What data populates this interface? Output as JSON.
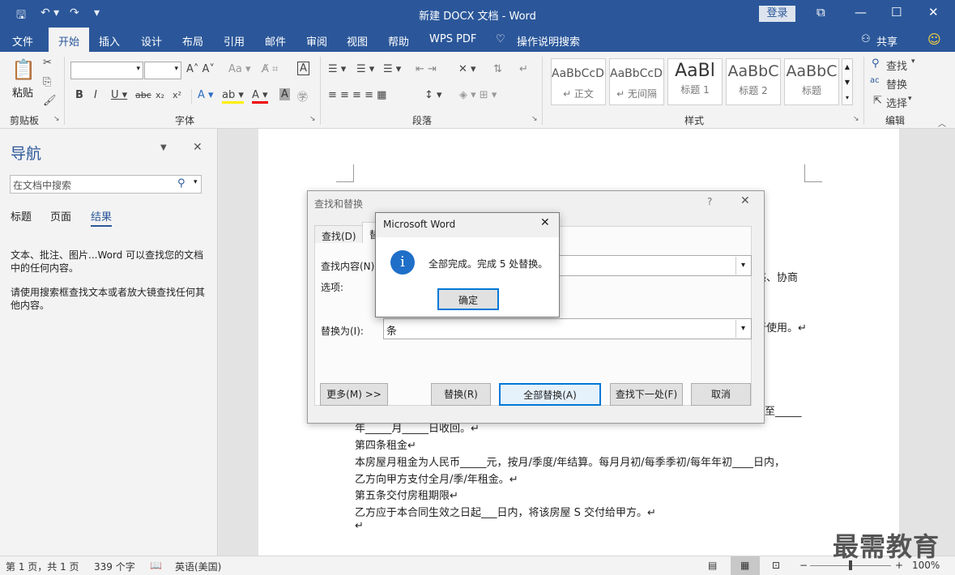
{
  "window": {
    "title": "新建 DOCX 文档  -  Word",
    "login": "登录"
  },
  "tabs": [
    "文件",
    "开始",
    "插入",
    "设计",
    "布局",
    "引用",
    "邮件",
    "审阅",
    "视图",
    "帮助",
    "WPS PDF",
    "操作说明搜索"
  ],
  "share": "共享",
  "ribbon": {
    "clipboard": {
      "paste": "粘贴",
      "label": "剪贴板"
    },
    "font": {
      "label": "字体"
    },
    "paragraph": {
      "label": "段落"
    },
    "styles": {
      "label": "样式",
      "items": [
        {
          "preview": "AaBbCcDı",
          "name": "↵ 正文"
        },
        {
          "preview": "AaBbCcDı",
          "name": "↵ 无间隔"
        },
        {
          "preview": "AaBl",
          "name": "标题 1"
        },
        {
          "preview": "AaBbC",
          "name": "标题 2"
        },
        {
          "preview": "AaBbC",
          "name": "标题"
        }
      ]
    },
    "editing": {
      "label": "编辑",
      "find": "查找",
      "replace": "替换",
      "select": "选择"
    }
  },
  "nav": {
    "title": "导航",
    "search_placeholder": "在文档中搜索",
    "tabs": [
      "标题",
      "页面",
      "结果"
    ],
    "text1": "文本、批注、图片...Word 可以查找您的文档中的任何内容。",
    "text2": "请使用搜索框查找文本或者放大镜查找任何其他内容。"
  },
  "document": {
    "peek1": "惑、协商",
    "peek2": "行使用。↵",
    "peek3": "至_____",
    "lines": [
      "年_____月_____日收回。↵",
      "第四条租金↵",
      "本房屋月租金为人民币_____元，按月/季度/年结算。每月月初/每季季初/每年年初____日内，",
      "乙方向甲方支付全月/季/年租金。↵",
      "第五条交付房租期限↵",
      "乙方应于本合同生效之日起___日内，将该房屋 S 交付给甲方。↵",
      "↵"
    ]
  },
  "find_dialog": {
    "title": "查找和替换",
    "tab_find": "查找(D)",
    "tab_replace": "替",
    "find_label": "查找内容(N):",
    "options_label": "选项:",
    "replace_label": "替换为(I):",
    "replace_value": "条",
    "btn_more": "更多(M) >>",
    "btn_replace": "替换(R)",
    "btn_replace_all": "全部替换(A)",
    "btn_find_next": "查找下一处(F)",
    "btn_cancel": "取消"
  },
  "msgbox": {
    "title": "Microsoft Word",
    "message": "全部完成。完成 5 处替换。",
    "ok": "确定"
  },
  "status": {
    "page": "第 1 页，共 1 页",
    "words": "339 个字",
    "lang": "英语(美国)",
    "zoom": "100%"
  },
  "watermark": "最需教育"
}
